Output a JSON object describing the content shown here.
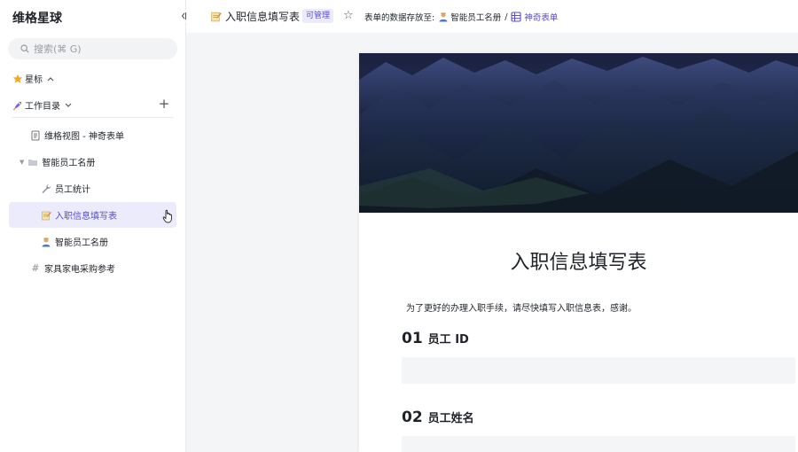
{
  "sidebar": {
    "workspace_title": "维格星球",
    "collapse_icon": "collapse-sidebar-icon",
    "search_placeholder": "搜索(⌘ G)",
    "starred_label": "星标",
    "catalog_label": "工作目录",
    "tree": [
      {
        "label": "维格视图 - 神奇表单",
        "icon": "document-icon"
      },
      {
        "label": "智能员工名册",
        "icon": "folder-icon"
      },
      {
        "label": "员工统计",
        "icon": "wrench-icon"
      },
      {
        "label": "入职信息填写表",
        "icon": "memo-icon",
        "active": true
      },
      {
        "label": "智能员工名册",
        "icon": "person-icon"
      },
      {
        "label": "家具家电采购参考",
        "icon": "hash-icon"
      }
    ]
  },
  "topbar": {
    "title": "入职信息填写表",
    "permission_badge": "可管理",
    "stored_prefix": "表单的数据存放至:",
    "stored_sheet": "智能员工名册",
    "separator": "/",
    "stored_view": "神奇表单"
  },
  "form": {
    "title": "入职信息填写表",
    "description": "为了更好的办理入职手续，请尽快填写入职信息表，感谢。",
    "questions": [
      {
        "number": "01",
        "label": "员工 ID"
      },
      {
        "number": "02",
        "label": "员工姓名"
      }
    ]
  },
  "colors": {
    "accent": "#5b4ccf",
    "active_bg": "#ecebfb",
    "main_bg": "#f4f5f7"
  }
}
